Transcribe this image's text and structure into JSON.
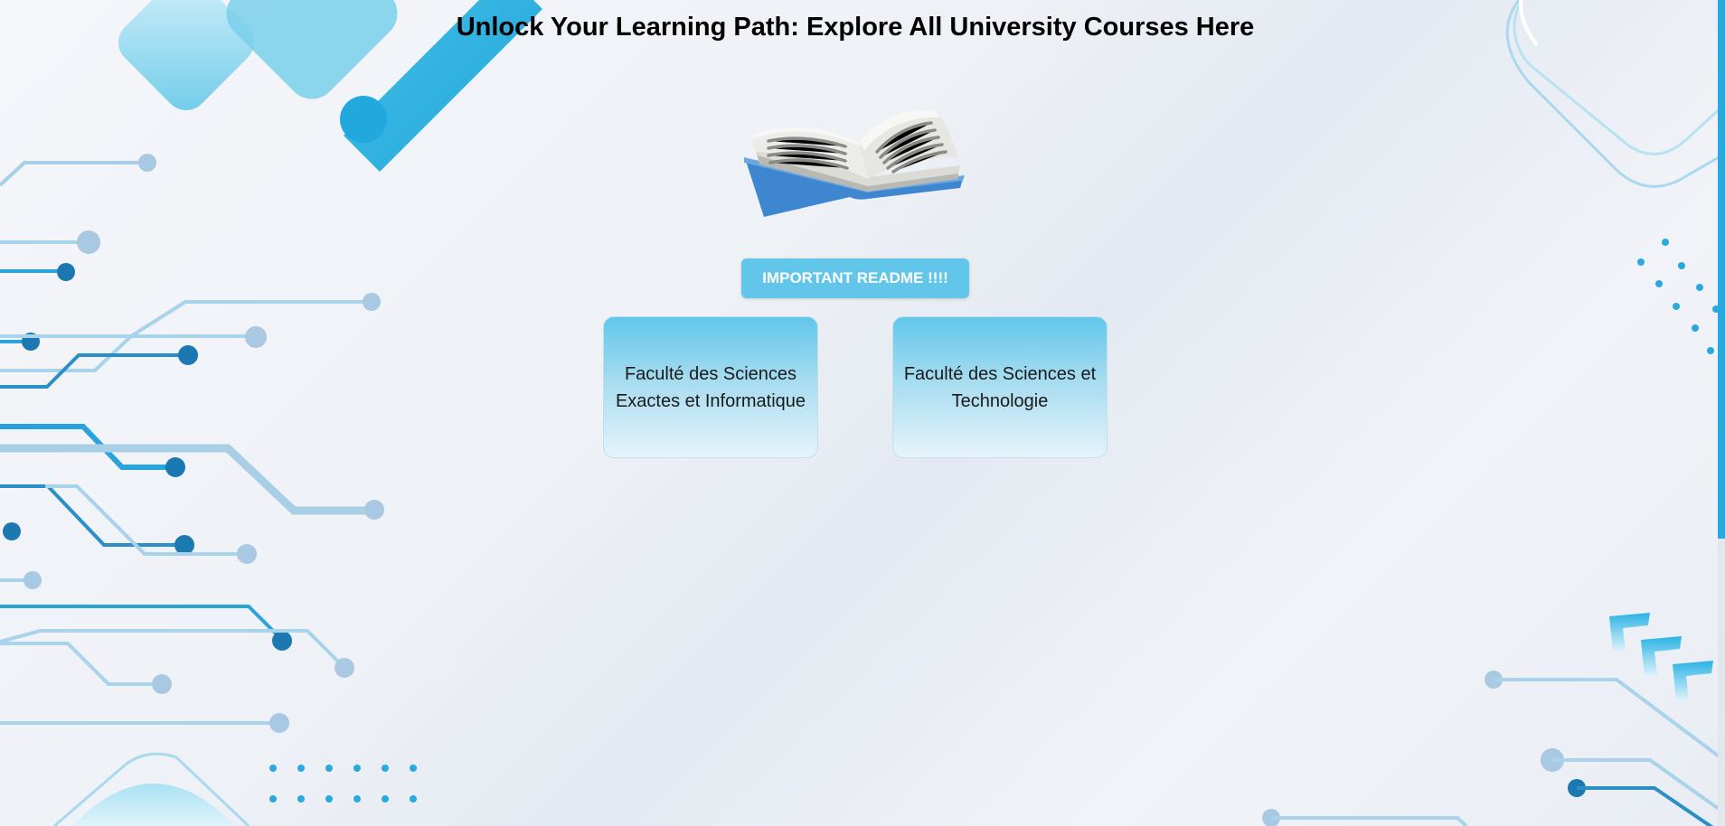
{
  "page": {
    "title": "Unlock Your Learning Path: Explore All University Courses Here"
  },
  "readme": {
    "label": "IMPORTANT README !!!!"
  },
  "faculties": [
    {
      "label": "Faculté des Sciences Exactes et Informatique"
    },
    {
      "label": "Faculté des Sciences et Technologie"
    }
  ],
  "icons": {
    "book": "open-book-icon"
  },
  "colors": {
    "accent": "#62c6ea",
    "accent_dark": "#1b78b0",
    "scroll_thumb": "#2aa9dc"
  }
}
